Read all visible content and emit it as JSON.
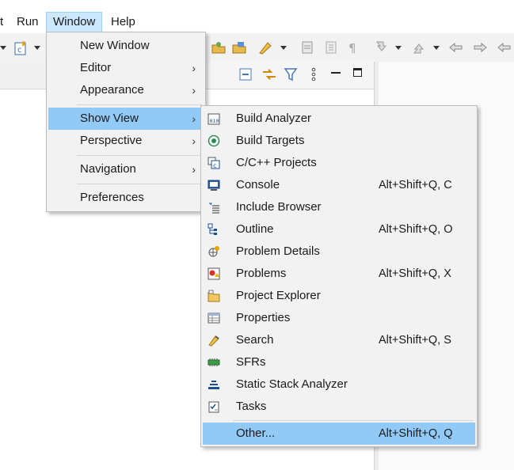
{
  "menubar": {
    "items": [
      {
        "label": "t"
      },
      {
        "label": "Run"
      },
      {
        "label": "Window"
      },
      {
        "label": "Help"
      }
    ]
  },
  "window_menu": {
    "items": [
      {
        "label": "New Window",
        "submenu": false
      },
      {
        "label": "Editor",
        "submenu": true
      },
      {
        "label": "Appearance",
        "submenu": true
      },
      {
        "label": "Show View",
        "submenu": true,
        "selected": true
      },
      {
        "label": "Perspective",
        "submenu": true
      },
      {
        "label": "Navigation",
        "submenu": true
      },
      {
        "label": "Preferences",
        "submenu": false
      }
    ]
  },
  "show_view_menu": {
    "items": [
      {
        "label": "Build Analyzer",
        "shortcut": "",
        "icon": "build-analyzer-icon"
      },
      {
        "label": "Build Targets",
        "shortcut": "",
        "icon": "build-targets-icon"
      },
      {
        "label": "C/C++ Projects",
        "shortcut": "",
        "icon": "cpp-projects-icon"
      },
      {
        "label": "Console",
        "shortcut": "Alt+Shift+Q, C",
        "icon": "console-icon"
      },
      {
        "label": "Include Browser",
        "shortcut": "",
        "icon": "include-browser-icon"
      },
      {
        "label": "Outline",
        "shortcut": "Alt+Shift+Q, O",
        "icon": "outline-icon"
      },
      {
        "label": "Problem Details",
        "shortcut": "",
        "icon": "problem-details-icon"
      },
      {
        "label": "Problems",
        "shortcut": "Alt+Shift+Q, X",
        "icon": "problems-icon"
      },
      {
        "label": "Project Explorer",
        "shortcut": "",
        "icon": "project-explorer-icon"
      },
      {
        "label": "Properties",
        "shortcut": "",
        "icon": "properties-icon"
      },
      {
        "label": "Search",
        "shortcut": "Alt+Shift+Q, S",
        "icon": "search-icon"
      },
      {
        "label": "SFRs",
        "shortcut": "",
        "icon": "sfrs-icon"
      },
      {
        "label": "Static Stack Analyzer",
        "shortcut": "",
        "icon": "static-stack-analyzer-icon"
      },
      {
        "label": "Tasks",
        "shortcut": "",
        "icon": "tasks-icon"
      },
      {
        "label": "Other...",
        "shortcut": "Alt+Shift+Q, Q",
        "icon": "",
        "selected": true
      }
    ]
  },
  "colors": {
    "selection": "#91c9f7",
    "menu_bg": "#f2f2f2",
    "menubar_highlight": "#cce8ff"
  }
}
